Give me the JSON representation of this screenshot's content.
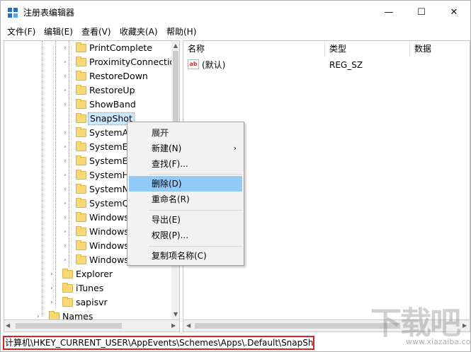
{
  "window": {
    "title": "注册表编辑器",
    "controls": {
      "minimize": "—",
      "maximize": "☐",
      "close": "✕"
    }
  },
  "menu": [
    "文件(F)",
    "编辑(E)",
    "查看(V)",
    "收藏夹(A)",
    "帮助(H)"
  ],
  "tree": {
    "items": [
      {
        "label": "PrintComplete",
        "arrow": "›"
      },
      {
        "label": "ProximityConnectio",
        "arrow": "›"
      },
      {
        "label": "RestoreDown",
        "arrow": "›"
      },
      {
        "label": "RestoreUp",
        "arrow": "›"
      },
      {
        "label": "ShowBand",
        "arrow": "›"
      },
      {
        "label": "SnapShot",
        "arrow": ""
      },
      {
        "label": "SystemAs",
        "arrow": "›"
      },
      {
        "label": "SystemEx",
        "arrow": "›"
      },
      {
        "label": "SystemEx",
        "arrow": "›"
      },
      {
        "label": "SystemHa",
        "arrow": "›"
      },
      {
        "label": "SystemNo",
        "arrow": "›"
      },
      {
        "label": "SystemQu",
        "arrow": "›"
      },
      {
        "label": "Windows",
        "arrow": "›"
      },
      {
        "label": "Windows",
        "arrow": "›"
      },
      {
        "label": "Windows",
        "arrow": "›"
      },
      {
        "label": "Windows",
        "arrow": "›"
      },
      {
        "label": "Explorer",
        "arrow": "›"
      },
      {
        "label": "iTunes",
        "arrow": "›"
      },
      {
        "label": "sapisvr",
        "arrow": "›"
      },
      {
        "label": "Names",
        "arrow": "›"
      }
    ]
  },
  "list": {
    "columns": [
      "名称",
      "类型",
      "数据"
    ],
    "rows": [
      {
        "icon": "ab",
        "name": "(默认)",
        "type": "REG_SZ",
        "data": ""
      }
    ]
  },
  "context_menu": {
    "items": [
      {
        "label": "展开",
        "bold": true
      },
      {
        "label": "新建(N)",
        "submenu": "›"
      },
      {
        "label": "查找(F)..."
      },
      {
        "label": "删除(D)",
        "highlight": true
      },
      {
        "label": "重命名(R)"
      },
      {
        "label": "导出(E)"
      },
      {
        "label": "权限(P)..."
      },
      {
        "label": "复制项名称(C)"
      }
    ]
  },
  "status": "计算机\\HKEY_CURRENT_USER\\AppEvents\\Schemes\\Apps\\.Default\\SnapShot",
  "watermark": {
    "text": "下载吧",
    "url": "www.xiazaiba.com"
  },
  "colors": {
    "highlight": "#91c9f7",
    "status_border": "#e02020",
    "folder": "#f8d775",
    "selection": "#cce8ff"
  }
}
